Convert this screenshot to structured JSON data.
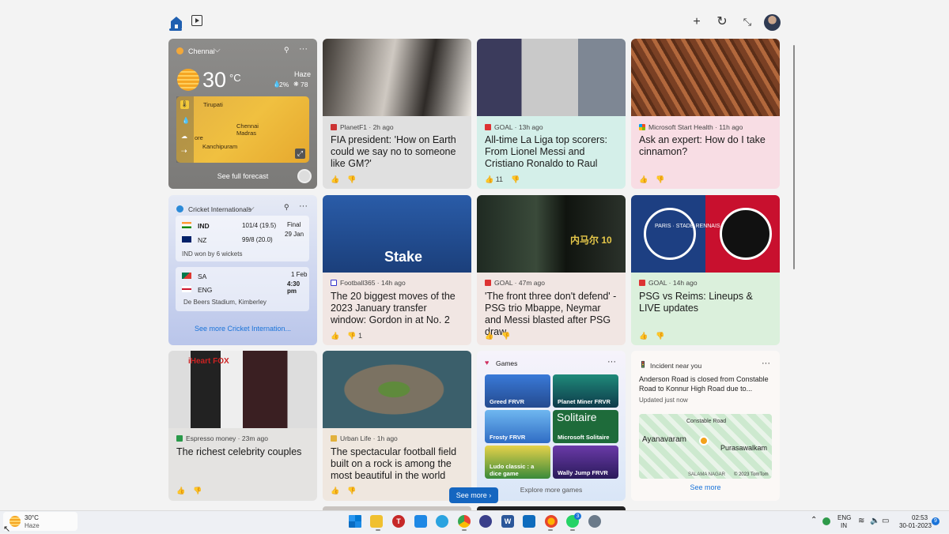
{
  "header": {
    "home_icon": "home-icon",
    "video_icon": "video-icon",
    "add_icon": "plus-icon",
    "refresh_icon": "refresh-icon",
    "collapse_icon": "collapse-icon"
  },
  "weather": {
    "location": "Chennai",
    "temp": "30",
    "unit": "°C",
    "condition": "Haze",
    "precip": "2%",
    "aqi": "78",
    "map_labels": [
      "Tirupati",
      "Chennai",
      "Madras",
      "ore",
      "Kanchipuram"
    ],
    "forecast_link": "See full forecast"
  },
  "cricket": {
    "title": "Cricket Internationals",
    "m1": {
      "team1": "IND",
      "score1": "101/4 (19.5)",
      "team2": "NZ",
      "score2": "99/8 (20.0)",
      "status": "Final",
      "date": "29 Jan",
      "result": "IND won by 6 wickets"
    },
    "m2": {
      "team1": "SA",
      "team2": "ENG",
      "date": "1 Feb",
      "time": "4:30 pm",
      "venue": "De Beers Stadium, Kimberley"
    },
    "more": "See more Cricket Internation..."
  },
  "news": [
    {
      "source": "PlanetF1 · 2h ago",
      "title": "FIA president: 'How on Earth could we say no to someone like GM?'",
      "likes": "",
      "dislikes": ""
    },
    {
      "source": "GOAL · 13h ago",
      "title": "All-time La Liga top scorers: From Lionel Messi and Cristiano Ronaldo to Raul",
      "likes": "11",
      "dislikes": ""
    },
    {
      "source": "Microsoft Start Health · 11h ago",
      "title": "Ask an expert: How do I take cinnamon?",
      "likes": "",
      "dislikes": ""
    },
    {
      "source": "Football365 · 14h ago",
      "title": "The 20 biggest moves of the 2023 January transfer window: Gordon in at No. 2",
      "likes": "",
      "dislikes": "1"
    },
    {
      "source": "GOAL · 47m ago",
      "title": "'The front three don't defend' - PSG trio Mbappe, Neymar and Messi blasted after PSG draw",
      "likes": "",
      "dislikes": ""
    },
    {
      "source": "GOAL · 14h ago",
      "title": "PSG vs Reims: Lineups & LIVE updates",
      "likes": "",
      "dislikes": ""
    },
    {
      "source": "Espresso money · 23m ago",
      "title": "The richest celebrity couples",
      "likes": "",
      "dislikes": ""
    },
    {
      "source": "Urban Life · 1h ago",
      "title": "The spectacular football field built on a rock is among the most beautiful in the world",
      "likes": "",
      "dislikes": ""
    }
  ],
  "images": {
    "n0": "",
    "n1": "",
    "n2": "",
    "n3": "Stake",
    "n4": "内马尔 10",
    "n5": "PARIS · STADE RENNAIS",
    "n6": "iHeart FOX",
    "n7": ""
  },
  "games": {
    "title": "Games",
    "items": [
      "Greed FRVR",
      "Planet Miner FRVR",
      "Frosty FRVR",
      "Microsoft Solitaire",
      "Ludo classic : a dice game",
      "Wally Jump FRVR"
    ],
    "solitaire_banner": "Solitaire",
    "explore": "Explore more games"
  },
  "incident": {
    "label": "Incident near you",
    "text": "Anderson Road is closed from Constable Road to Konnur High Road due to...",
    "updated": "Updated just now",
    "map_labels": [
      "Constable Road",
      "Ayanavaram",
      "Purasawalkam",
      "SALAMA NAGAR",
      "© 2023 TomTom"
    ],
    "more": "See more"
  },
  "see_more": "See more",
  "taskbar": {
    "temp": "30°C",
    "cond": "Haze",
    "lang1": "ENG",
    "lang2": "IN",
    "time": "02:53",
    "date": "30-01-2023",
    "badge": "9",
    "whatsapp_badge": "3"
  },
  "colors": {
    "accent": "#1a73d9",
    "see_more_bg": "#1566c0"
  }
}
